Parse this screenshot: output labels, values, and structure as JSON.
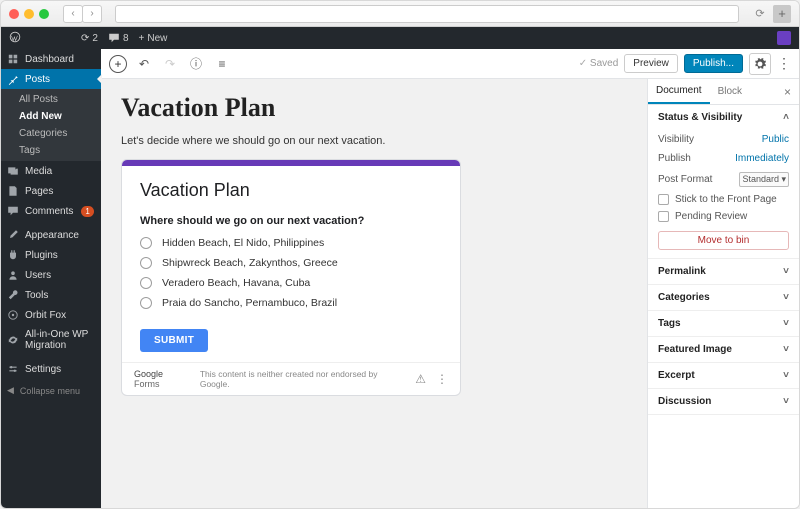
{
  "admin_bar": {
    "refresh_count": "2",
    "comments_count": "8",
    "new_label": "New"
  },
  "sidebar": {
    "items": [
      {
        "label": "Dashboard"
      },
      {
        "label": "Posts"
      },
      {
        "label": "Media"
      },
      {
        "label": "Pages"
      },
      {
        "label": "Comments"
      },
      {
        "label": "Appearance"
      },
      {
        "label": "Plugins"
      },
      {
        "label": "Users"
      },
      {
        "label": "Tools"
      },
      {
        "label": "Orbit Fox"
      },
      {
        "label": "All-in-One WP Migration"
      },
      {
        "label": "Settings"
      }
    ],
    "posts_sub": [
      "All Posts",
      "Add New",
      "Categories",
      "Tags"
    ],
    "comments_badge": "1",
    "collapse_label": "Collapse menu"
  },
  "editor": {
    "saved_label": "Saved",
    "preview_label": "Preview",
    "publish_label": "Publish...",
    "post_title": "Vacation Plan",
    "post_para": "Let's decide where we should go on our next vacation."
  },
  "form": {
    "title": "Vacation Plan",
    "question": "Where should we go on our next vacation?",
    "options": [
      "Hidden Beach, El Nido, Philippines",
      "Shipwreck Beach, Zakynthos, Greece",
      "Veradero Beach, Havana, Cuba",
      "Praia do Sancho, Pernambuco, Brazil"
    ],
    "submit_label": "SUBMIT",
    "brand_a": "Google",
    "brand_b": " Forms",
    "disclaimer": "This content is neither created nor endorsed by Google."
  },
  "settings": {
    "tab_document": "Document",
    "tab_block": "Block",
    "panels": {
      "status": {
        "title": "Status & Visibility",
        "visibility_label": "Visibility",
        "visibility_value": "Public",
        "publish_label": "Publish",
        "publish_value": "Immediately",
        "format_label": "Post Format",
        "format_value": "Standard",
        "stick_label": "Stick to the Front Page",
        "pending_label": "Pending Review",
        "move_bin": "Move to bin"
      },
      "permalink": "Permalink",
      "categories": "Categories",
      "tags": "Tags",
      "featured": "Featured Image",
      "excerpt": "Excerpt",
      "discussion": "Discussion"
    }
  }
}
